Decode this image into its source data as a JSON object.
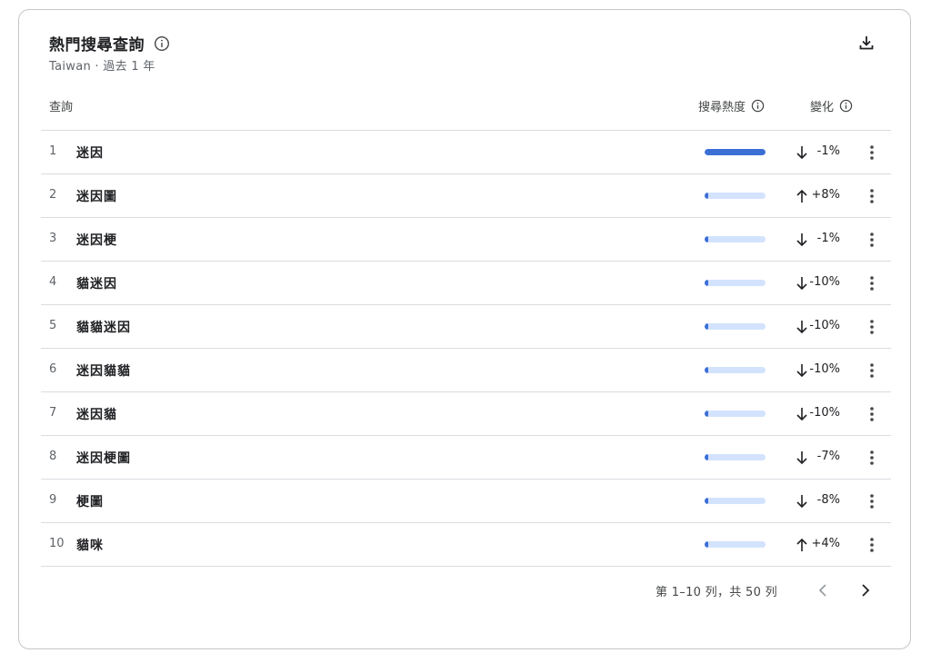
{
  "header": {
    "title": "熱門搜尋查詢",
    "subtitle": "Taiwan · 過去 1 年",
    "info_icon": "info-icon",
    "download_icon": "download-icon"
  },
  "columns": {
    "query": "查詢",
    "interest": "搜尋熱度",
    "change": "變化"
  },
  "rows": [
    {
      "rank": "1",
      "term": "迷因",
      "interest": 100,
      "direction": "down",
      "change": "-1%"
    },
    {
      "rank": "2",
      "term": "迷因圖",
      "interest": 4,
      "direction": "up",
      "change": "+8%"
    },
    {
      "rank": "3",
      "term": "迷因梗",
      "interest": 4,
      "direction": "down",
      "change": "-1%"
    },
    {
      "rank": "4",
      "term": "貓迷因",
      "interest": 3,
      "direction": "down",
      "change": "-10%"
    },
    {
      "rank": "5",
      "term": "貓貓迷因",
      "interest": 3,
      "direction": "down",
      "change": "-10%"
    },
    {
      "rank": "6",
      "term": "迷因貓貓",
      "interest": 3,
      "direction": "down",
      "change": "-10%"
    },
    {
      "rank": "7",
      "term": "迷因貓",
      "interest": 3,
      "direction": "down",
      "change": "-10%"
    },
    {
      "rank": "8",
      "term": "迷因梗圖",
      "interest": 3,
      "direction": "down",
      "change": "-7%"
    },
    {
      "rank": "9",
      "term": "梗圖",
      "interest": 3,
      "direction": "down",
      "change": "-8%"
    },
    {
      "rank": "10",
      "term": "貓咪",
      "interest": 2,
      "direction": "up",
      "change": "+4%"
    }
  ],
  "pagination": {
    "label": "第 1–10 列，共 50 列",
    "prev_icon": "chevron-left-icon",
    "next_icon": "chevron-right-icon"
  },
  "colors": {
    "bar_fill": "#3c6fd6",
    "bar_track": "#d3e3fd"
  }
}
